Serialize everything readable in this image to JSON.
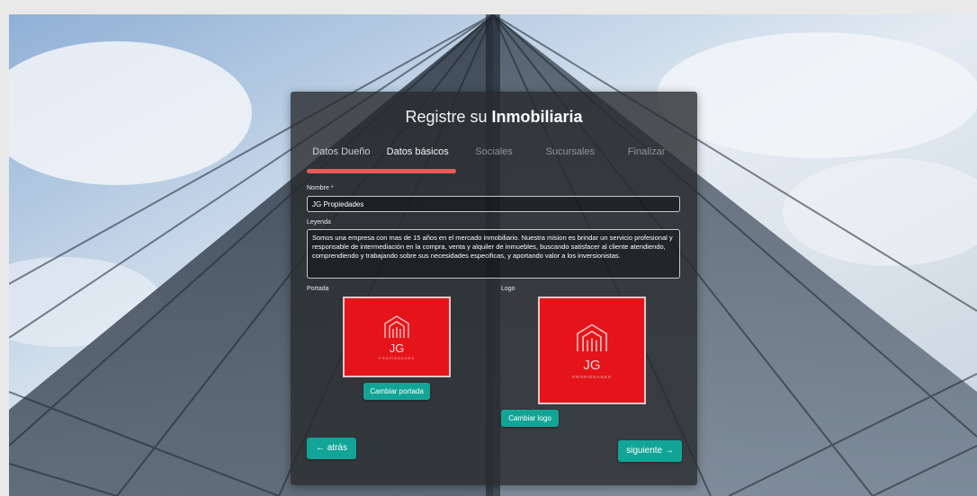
{
  "header": {
    "title_prefix": "Registre su",
    "title_bold": "Inmobiliaria"
  },
  "steps": [
    {
      "label": "Datos Dueño",
      "state": "done"
    },
    {
      "label": "Datos básicos",
      "state": "current"
    },
    {
      "label": "Sociales",
      "state": "pending"
    },
    {
      "label": "Sucursales",
      "state": "pending"
    },
    {
      "label": "Finalizar",
      "state": "pending"
    }
  ],
  "progress": {
    "fraction": 0.4,
    "color": "#e85959"
  },
  "form": {
    "nombre_label": "Nombre *",
    "nombre_value": "JG Propiedades",
    "leyenda_label": "Leyenda",
    "leyenda_value": "Somos una empresa con mas de 15 años en el mercado inmobiliario. Nuestra mision es brindar un servicio profesional y responsable de intermediación en la compra, venta y alquiler de inmuebles, buscando satisfacer al cliente atendiendo, comprendiendo y trabajando sobre sus necesidades especificas, y aportando valor a los inversionistas.",
    "portada_label": "Portada",
    "logo_label": "Logo"
  },
  "portada_image": {
    "brand_name": "JG",
    "brand_sub": "PROPIEDADES",
    "background": "#e5141b"
  },
  "logo_image": {
    "brand_name": "JG",
    "brand_sub": "PROPIEDADES",
    "background": "#e5141b"
  },
  "buttons": {
    "cambiar_portada": "Cambiar portada",
    "cambiar_logo": "Cambiar logo",
    "back": "← atrás",
    "next": "siguiente →"
  },
  "colors": {
    "accent_teal": "#12a597",
    "panel_bg": "rgba(40,42,45,0.80)"
  }
}
